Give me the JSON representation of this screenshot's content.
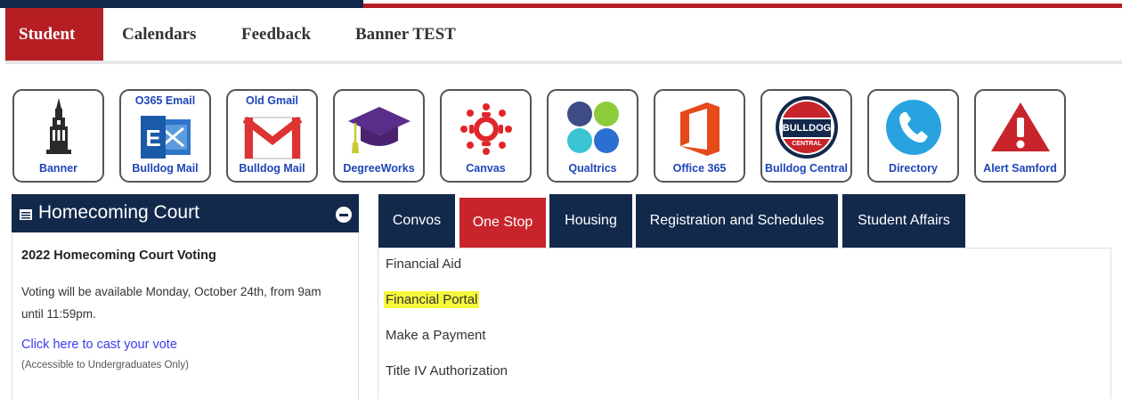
{
  "nav": {
    "items": [
      {
        "label": "Student",
        "active": true
      },
      {
        "label": "Calendars"
      },
      {
        "label": "Feedback"
      },
      {
        "label": "Banner TEST"
      }
    ]
  },
  "tiles": [
    {
      "top": "",
      "label": "Banner",
      "icon": "chapel-icon"
    },
    {
      "top": "O365 Email",
      "label": "Bulldog Mail",
      "icon": "exchange-icon"
    },
    {
      "top": "Old Gmail",
      "label": "Bulldog Mail",
      "icon": "gmail-icon"
    },
    {
      "top": "",
      "label": "DegreeWorks",
      "icon": "graduation-cap-icon"
    },
    {
      "top": "",
      "label": "Canvas",
      "icon": "canvas-icon"
    },
    {
      "top": "",
      "label": "Qualtrics",
      "icon": "qualtrics-icon"
    },
    {
      "top": "",
      "label": "Office 365",
      "icon": "office-icon"
    },
    {
      "top": "",
      "label": "Bulldog Central",
      "icon": "bulldog-central-icon",
      "badge_top": "BULLDOG",
      "badge_bottom": "CENTRAL"
    },
    {
      "top": "",
      "label": "Directory",
      "icon": "phone-icon"
    },
    {
      "top": "",
      "label": "Alert Samford",
      "icon": "alert-icon"
    }
  ],
  "panel": {
    "title": "Homecoming Court",
    "vote_title": "2022 Homecoming Court Voting",
    "vote_text": "Voting will be available Monday, October 24th, from 9am until 11:59pm.",
    "vote_link": "Click here to cast your vote",
    "vote_note": "(Accessible to Undergraduates Only)"
  },
  "tabs": [
    {
      "label": "Convos"
    },
    {
      "label": "One Stop",
      "active": true
    },
    {
      "label": "Housing"
    },
    {
      "label": "Registration and Schedules"
    },
    {
      "label": "Student Affairs"
    }
  ],
  "links": [
    {
      "label": "Financial Aid"
    },
    {
      "label": "Financial Portal",
      "highlighted": true
    },
    {
      "label": "Make a Payment"
    },
    {
      "label": "Title IV Authorization"
    }
  ],
  "colors": {
    "navy": "#13294b",
    "red": "#b51f24",
    "highlight": "#f5f73a",
    "link_blue": "#3b3bf0"
  }
}
